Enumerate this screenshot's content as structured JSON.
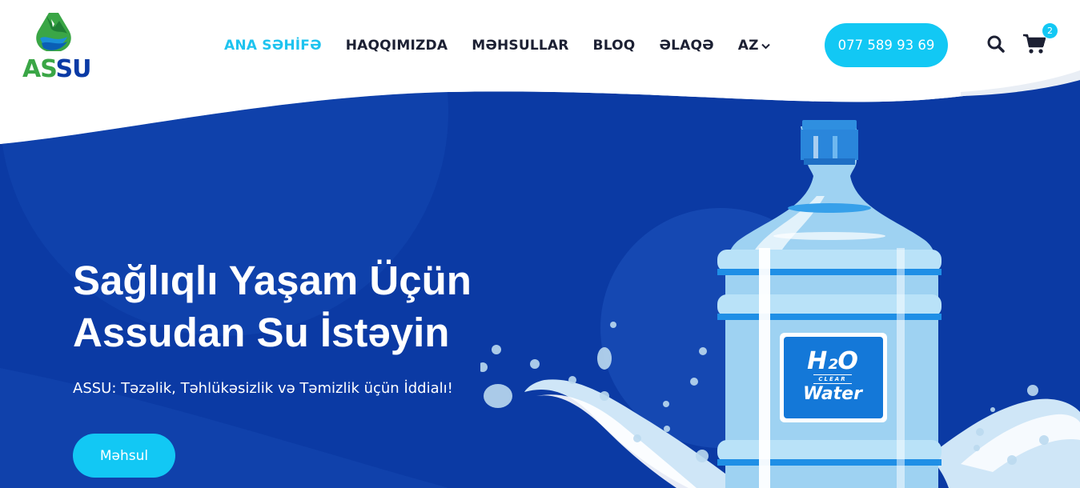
{
  "brand": {
    "logo_text_1": "AS",
    "logo_text_2": "SU"
  },
  "nav": {
    "items": [
      {
        "label": "ANA SƏHİFƏ",
        "active": true
      },
      {
        "label": "HAQQIMIZDA",
        "active": false
      },
      {
        "label": "MƏHSULLAR",
        "active": false
      },
      {
        "label": "BLOQ",
        "active": false
      },
      {
        "label": "ƏLAQƏ",
        "active": false
      }
    ],
    "language": "AZ"
  },
  "header": {
    "phone": "077 589 93 69",
    "cart_count": "2"
  },
  "hero": {
    "title_line1": "Sağlıqlı Yaşam Üçün",
    "title_line2": "Assudan Su İstəyin",
    "subtitle": "ASSU: Təzəlik, Təhlükəsizlik və Təmizlik üçün İddialı!",
    "cta_label": "Məhsul",
    "label_h2o": "H₂O",
    "label_clear": "CLEAR",
    "label_water": "Water"
  },
  "colors": {
    "accent": "#12c8f4",
    "hero_bg": "#0b3aa4",
    "nav_text": "#1c2033",
    "logo_green": "#3aa646",
    "logo_blue": "#0a3aa5"
  },
  "icons": [
    "search-icon",
    "cart-icon",
    "chevron-down-icon",
    "logo-mountain-icon"
  ]
}
